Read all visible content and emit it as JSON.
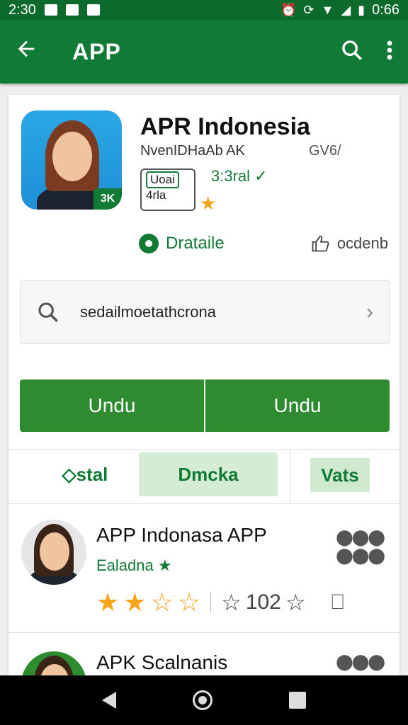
{
  "status_bar": {
    "time_left": "2:30",
    "time_right": "0:66"
  },
  "app_bar": {
    "title": "APP"
  },
  "app_info": {
    "title": "APR Indonesia",
    "developer": "NvenIDHaAb AK",
    "version": "GV6/",
    "rating_box_line1": "Uoai",
    "rating_box_line2": "4rla",
    "score": "3:3ral ✓",
    "badge": "3K",
    "details_label": "Drataile",
    "share_label": "ocdenb"
  },
  "search": {
    "text": "sedailmoetathcrona"
  },
  "buttons": {
    "left": "Undu",
    "right": "Undu"
  },
  "tabs": [
    {
      "label": "◇stal"
    },
    {
      "label": "Dmcka"
    },
    {
      "label": "Vats"
    }
  ],
  "list": [
    {
      "title": "APP Indonasa APP",
      "subtitle": "Ealadna ★",
      "review_count": "102"
    },
    {
      "title": "APK Scalnanis"
    }
  ],
  "colors": {
    "primary": "#117a35",
    "status": "#0b6a2c",
    "button": "#2e8b30",
    "star": "#f7a51c"
  }
}
